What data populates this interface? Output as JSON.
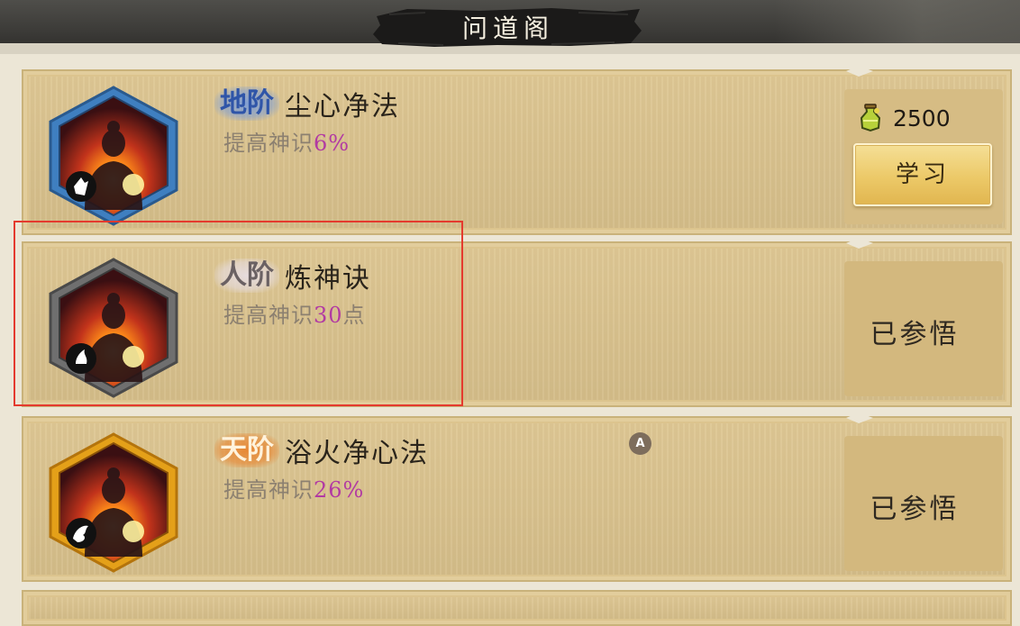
{
  "header": {
    "title": "问道阁"
  },
  "skills": [
    {
      "grade": "地阶",
      "name": "尘心净法",
      "desc_prefix": "提高神识",
      "desc_value": "6%",
      "desc_suffix": "",
      "frame_color": "#3f7fc0",
      "cost_icon": "spirit-potion-icon",
      "cost": "2500",
      "button_label": "学习"
    },
    {
      "grade": "人阶",
      "name": "炼神诀",
      "desc_prefix": "提高神识",
      "desc_value": "30",
      "desc_suffix": "点",
      "frame_color": "#6f6f6f",
      "status": "已参悟"
    },
    {
      "grade": "天阶",
      "name": "浴火净心法",
      "desc_prefix": "提高神识",
      "desc_value": "26%",
      "desc_suffix": "",
      "frame_color": "#e4a019",
      "status": "已参悟"
    }
  ],
  "marker": {
    "label": "A"
  },
  "colors": {
    "highlight_border": "#e43a2e",
    "value_text": "#b23aa3",
    "card_bg": "#dcc48e"
  }
}
